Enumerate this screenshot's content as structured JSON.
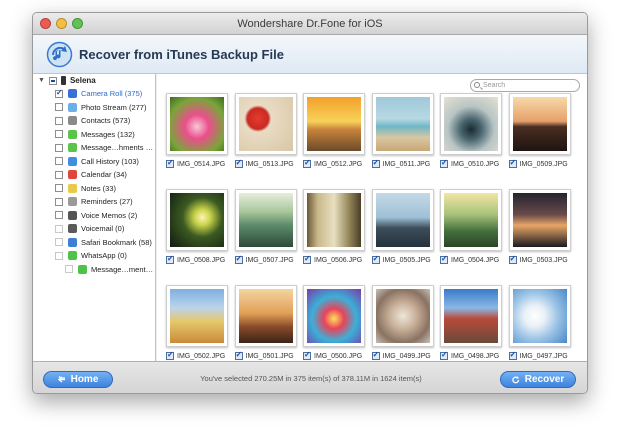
{
  "window": {
    "title": "Wondershare Dr.Fone for iOS"
  },
  "header": {
    "title": "Recover from iTunes Backup File",
    "icon": "itunes-backup-icon"
  },
  "sidebar": {
    "device": "Selena",
    "items": [
      {
        "label": "Camera Roll (375)",
        "checked": "on",
        "selected": true,
        "icon": "camera-roll-icon",
        "color": "#3a6fd8"
      },
      {
        "label": "Photo Stream (277)",
        "checked": "off",
        "icon": "photo-stream-icon",
        "color": "#6bb0e8"
      },
      {
        "label": "Contacts (573)",
        "checked": "off",
        "icon": "contacts-icon",
        "color": "#8a8a8a"
      },
      {
        "label": "Messages (132)",
        "checked": "off",
        "icon": "messages-icon",
        "color": "#5bc24a"
      },
      {
        "label": "Message…hments (10)",
        "checked": "off",
        "icon": "message-attachments-icon",
        "color": "#5bc24a"
      },
      {
        "label": "Call History (103)",
        "checked": "off",
        "icon": "call-history-icon",
        "color": "#3f8fe0"
      },
      {
        "label": "Calendar (34)",
        "checked": "off",
        "icon": "calendar-icon",
        "color": "#e0463c"
      },
      {
        "label": "Notes (33)",
        "checked": "off",
        "icon": "notes-icon",
        "color": "#e9c94a"
      },
      {
        "label": "Reminders (27)",
        "checked": "off",
        "icon": "reminders-icon",
        "color": "#9a9a9a"
      },
      {
        "label": "Voice Memos (2)",
        "checked": "off",
        "icon": "voice-memos-icon",
        "color": "#555555"
      },
      {
        "label": "Voicemail (0)",
        "checked": "dim",
        "icon": "voicemail-icon",
        "color": "#5a5a5a"
      },
      {
        "label": "Safari Bookmark (58)",
        "checked": "dim",
        "icon": "safari-icon",
        "color": "#3d7ed6"
      },
      {
        "label": "WhatsApp (0)",
        "checked": "dim",
        "icon": "whatsapp-icon",
        "color": "#4fc24a"
      },
      {
        "label": "Message…ments (0)",
        "checked": "dim",
        "sub": true,
        "icon": "whatsapp-attachments-icon",
        "color": "#4fc24a"
      }
    ]
  },
  "search": {
    "placeholder": "Search"
  },
  "photos": [
    {
      "name": "IMG_0514.JPG",
      "bg": "radial-gradient(circle at 50% 55%, #f7c8d8 0%, #ea4f8b 30%, #7aa53a 70%, #3f6b22 100%)"
    },
    {
      "name": "IMG_0513.JPG",
      "bg": "radial-gradient(circle at 35% 40%, #e83a2f 0%, #c82a22 22%, #e9dcc4 28%, #d8c6a6 100%)"
    },
    {
      "name": "IMG_0512.JPG",
      "bg": "linear-gradient(#f2a12a 0%, #f7d25a 45%, #c9843c 60%, #6a4a2a 100%)"
    },
    {
      "name": "IMG_0511.JPG",
      "bg": "linear-gradient(#9ec9da 0%, #b8d8e3 40%, #6fb7c7 55%, #d9c7a2 75%, #c6a777 100%)"
    },
    {
      "name": "IMG_0510.JPG",
      "bg": "radial-gradient(circle at 50% 60%, #1a2a30 0%, #4a6670 25%, #b8c5c4 55%, #e6e1d2 100%)"
    },
    {
      "name": "IMG_0509.JPG",
      "bg": "linear-gradient(#f6d9a8 0%, #e6a06a 45%, #4a2e22 55%, #1e1410 100%)"
    },
    {
      "name": "IMG_0508.JPG",
      "bg": "radial-gradient(circle at 60% 45%, #fff4b8 0%, #c9d44a 18%, #3c5a22 45%, #0f1a10 100%)"
    },
    {
      "name": "IMG_0507.JPG",
      "bg": "linear-gradient(#e6eedc 0%, #a7c69a 35%, #5c8a6a 60%, #2e4a3a 100%)"
    },
    {
      "name": "IMG_0506.JPG",
      "bg": "linear-gradient(90deg, #6a5a3a 0%, #c9b889 20%, #e8e0c2 50%, #9c8f62 75%, #4a3e26 100%)"
    },
    {
      "name": "IMG_0505.JPG",
      "bg": "linear-gradient(#c4d9e6 0%, #9fc0d6 45%, #3d4e5a 65%, #24323c 100%)"
    },
    {
      "name": "IMG_0504.JPG",
      "bg": "linear-gradient(#f2e6a4 0%, #a6c27a 40%, #45703e 70%, #2a4426 100%)"
    },
    {
      "name": "IMG_0503.JPG",
      "bg": "linear-gradient(#23242e 0%, #6a4a4a 40%, #e8a566 60%, #1a1a22 100%)"
    },
    {
      "name": "IMG_0502.JPG",
      "bg": "linear-gradient(#7fb0e0 0%, #bcd4ea 35%, #e6c76a 60%, #c98a3a 100%)"
    },
    {
      "name": "IMG_0501.JPG",
      "bg": "linear-gradient(#f5d4a0 0%, #e0a055 45%, #8a4a2a 70%, #3a2418 100%)"
    },
    {
      "name": "IMG_0500.JPG",
      "bg": "radial-gradient(circle at 50% 55%, #ffe25a 0%, #e8435a 25%, #3bb0d8 55%, #7a3aa8 100%)"
    },
    {
      "name": "IMG_0499.JPG",
      "bg": "radial-gradient(circle at 50% 50%, #efe6da 0%, #c8b09a 35%, #8a7262 70%, #c7c0b6 100%)"
    },
    {
      "name": "IMG_0498.JPG",
      "bg": "linear-gradient(#3a7ac8 0%, #8ab8e6 35%, #b84a3a 55%, #6a4a3a 100%)"
    },
    {
      "name": "IMG_0497.JPG",
      "bg": "radial-gradient(circle at 40% 50%, #ffffff 0%, #e9f0f7 25%, #9cc4e6 55%, #4a88c8 100%)"
    }
  ],
  "footer": {
    "home_label": "Home",
    "recover_label": "Recover",
    "status": "You've selected 270.25M in 375 item(s) of 378.11M in 1624 item(s)"
  }
}
